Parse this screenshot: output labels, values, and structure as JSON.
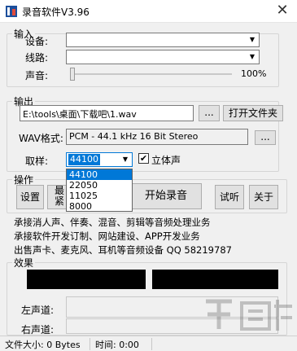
{
  "window": {
    "title": "录音软件V3.96",
    "close": "✕"
  },
  "input_group": {
    "legend": "输入",
    "device_label": "设备:",
    "device_value": "",
    "line_label": "线路:",
    "line_value": "",
    "volume_label": "声音:",
    "volume_percent": "100%",
    "volume_level": 0.0
  },
  "output_group": {
    "legend": "输出",
    "path_value": "E:\\tools\\桌面\\下载吧\\1.wav",
    "browse_label": "...",
    "open_folder_label": "打开文件夹",
    "wav_label": "WAV格式:",
    "wav_value": "PCM - 44.1 kHz 16 Bit Stereo",
    "wav_browse_label": "...",
    "sample_label": "取样:",
    "sample_value": "44100",
    "stereo_label": "立体声",
    "stereo_checked": true,
    "sample_options": [
      "44100",
      "22050",
      "11025",
      "8000"
    ]
  },
  "operation_group": {
    "legend": "操作",
    "settings_label": "设置",
    "hidden_label_1": "最",
    "hidden_label_2": "紧",
    "record_label": "开始录音",
    "listen_label": "试听",
    "about_label": "关于"
  },
  "info_lines": [
    "承接消人声、伴奏、混音、剪辑等音频处理业务",
    "承接软件开发订制、网站建设、APP开发业务",
    "出售声卡、麦克风、耳机等音频设备 QQ 58219787"
  ],
  "effect_group": {
    "legend": "效果",
    "left_label": "左声道:",
    "right_label": "右声道:"
  },
  "status": {
    "file_size": "文件大小: 0 Bytes",
    "time": "时间: 0:00"
  },
  "colors": {
    "accent": "#0078d7",
    "meter": "#000000"
  }
}
